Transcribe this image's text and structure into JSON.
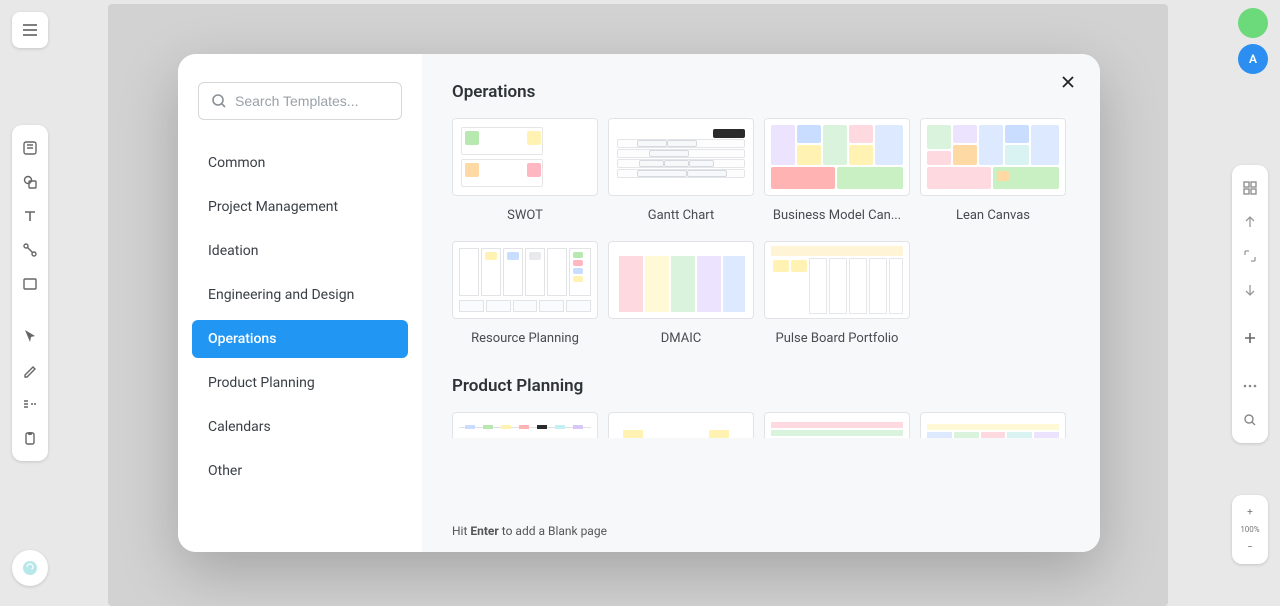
{
  "search": {
    "placeholder": "Search Templates..."
  },
  "categories": [
    {
      "label": "Common",
      "selected": false
    },
    {
      "label": "Project Management",
      "selected": false
    },
    {
      "label": "Ideation",
      "selected": false
    },
    {
      "label": "Engineering and Design",
      "selected": false
    },
    {
      "label": "Operations",
      "selected": true
    },
    {
      "label": "Product Planning",
      "selected": false
    },
    {
      "label": "Calendars",
      "selected": false
    },
    {
      "label": "Other",
      "selected": false
    }
  ],
  "sections": {
    "operations": {
      "title": "Operations",
      "templates": [
        "SWOT",
        "Gantt Chart",
        "Business Model Can...",
        "Lean Canvas",
        "Resource Planning",
        "DMAIC",
        "Pulse Board Portfolio"
      ]
    },
    "product_planning": {
      "title": "Product Planning"
    }
  },
  "hint": {
    "prefix": "Hit ",
    "key": "Enter",
    "suffix": " to add a Blank page"
  },
  "right_zoom_label": "100%"
}
